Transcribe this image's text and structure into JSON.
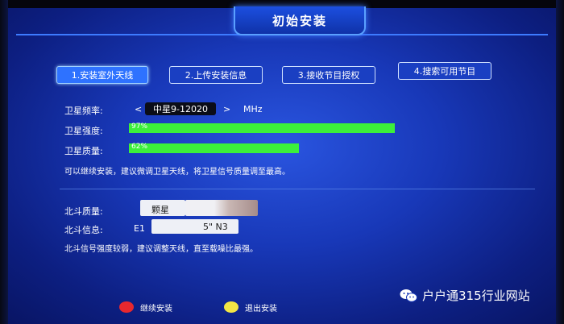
{
  "header": {
    "title": "初始安装"
  },
  "steps": [
    {
      "label": "1.安装室外天线"
    },
    {
      "label": "2.上传安装信息"
    },
    {
      "label": "3.接收节目授权"
    },
    {
      "label": "4.搜索可用节目"
    }
  ],
  "satellite": {
    "freq_label": "卫星频率:",
    "freq_left_arrow": "<",
    "freq_value": "中星9-12020",
    "freq_right_arrow": ">",
    "freq_unit": "MHz",
    "strength_label": "卫星强度:",
    "strength_value": "97%",
    "strength_fraction": 0.97,
    "quality_label": "卫星质量:",
    "quality_value": "62%",
    "quality_fraction": 0.62,
    "hint": "可以继续安装，建议微调卫星天线，将卫星信号质量调至最高。"
  },
  "beidou": {
    "quality_label": "北斗质量:",
    "quality_value": "颗星",
    "info_label": "北斗信息:",
    "info_prefix": "E1",
    "info_suffix": "5\" N3",
    "hint": "北斗信号强度较弱，建议调整天线，直至载噪比最强。"
  },
  "footer": {
    "continue_label": "继续安装",
    "exit_label": "退出安装"
  },
  "watermark": {
    "text": "户户通315行业网站"
  },
  "colors": {
    "signal_bar": "#3cf03a",
    "red_button": "#e8282e",
    "yellow_button": "#f3e645"
  }
}
